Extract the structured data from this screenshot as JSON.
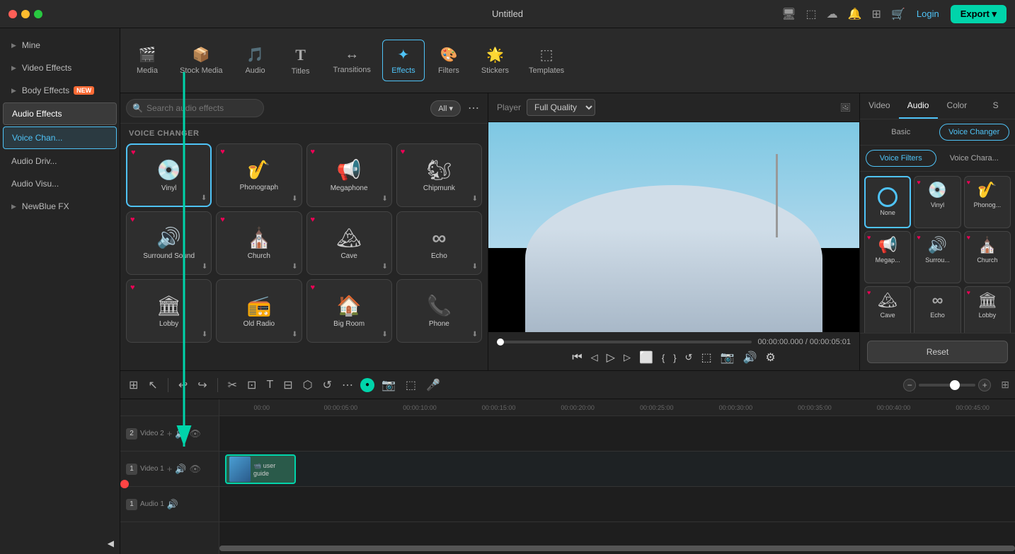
{
  "titlebar": {
    "title": "Untitled",
    "login_label": "Login",
    "export_label": "Export ▾"
  },
  "nav": {
    "items": [
      {
        "id": "media",
        "icon": "🎬",
        "label": "Media"
      },
      {
        "id": "stock_media",
        "icon": "📦",
        "label": "Stock Media"
      },
      {
        "id": "audio",
        "icon": "🎵",
        "label": "Audio"
      },
      {
        "id": "titles",
        "icon": "T",
        "label": "Titles"
      },
      {
        "id": "transitions",
        "icon": "↔",
        "label": "Transitions"
      },
      {
        "id": "effects",
        "icon": "✨",
        "label": "Effects",
        "active": true
      },
      {
        "id": "filters",
        "icon": "🎨",
        "label": "Filters"
      },
      {
        "id": "stickers",
        "icon": "🌟",
        "label": "Stickers"
      },
      {
        "id": "templates",
        "icon": "⬜",
        "label": "Templates"
      }
    ]
  },
  "sidebar": {
    "items": [
      {
        "id": "mine",
        "label": "Mine",
        "arrow": "▶"
      },
      {
        "id": "video_effects",
        "label": "Video Effects",
        "arrow": "▶"
      },
      {
        "id": "body_effects",
        "label": "Body Effects",
        "badge": "NEW",
        "arrow": "▶"
      },
      {
        "id": "audio_effects",
        "label": "Audio Effects",
        "active": true
      },
      {
        "id": "voice_chan",
        "label": "Voice Chan...",
        "active_sub": true
      },
      {
        "id": "audio_driv",
        "label": "Audio Driv..."
      },
      {
        "id": "audio_visu",
        "label": "Audio Visu..."
      },
      {
        "id": "newblue_fx",
        "label": "NewBlue FX",
        "arrow": "▶"
      }
    ]
  },
  "effects_panel": {
    "search_placeholder": "Search audio effects",
    "filter_label": "All",
    "section_label": "VOICE CHANGER",
    "effects": [
      {
        "id": "vinyl",
        "icon": "💿",
        "label": "Vinyl",
        "heart": true,
        "dl": true,
        "active": true
      },
      {
        "id": "phonograph",
        "icon": "🪗",
        "label": "Phonograph",
        "heart": true,
        "dl": true
      },
      {
        "id": "megaphone",
        "icon": "📢",
        "label": "Megaphone",
        "heart": true,
        "dl": true
      },
      {
        "id": "chipmunk",
        "icon": "🐿",
        "label": "Chipmunk",
        "heart": true,
        "dl": true
      },
      {
        "id": "surround_sound",
        "icon": "🔊",
        "label": "Surround Sound",
        "heart": true,
        "dl": true
      },
      {
        "id": "church",
        "icon": "⛪",
        "label": "Church",
        "heart": true,
        "dl": true
      },
      {
        "id": "cave",
        "icon": "🏔",
        "label": "Cave",
        "heart": true,
        "dl": true
      },
      {
        "id": "echo",
        "icon": "∞",
        "label": "Echo",
        "dl": true
      },
      {
        "id": "lobby",
        "icon": "🏛",
        "label": "Lobby",
        "heart": true,
        "dl": true
      },
      {
        "id": "old_radio",
        "icon": "📻",
        "label": "Old Radio",
        "dl": true
      },
      {
        "id": "big_room",
        "icon": "🏠",
        "label": "Big Room",
        "heart": true,
        "dl": true
      },
      {
        "id": "phone",
        "icon": "📞",
        "label": "Phone",
        "dl": true
      }
    ]
  },
  "player": {
    "label": "Player",
    "quality": "Full Quality",
    "time_current": "00:00:00.000",
    "time_total": "00:00:05:01"
  },
  "right_panel": {
    "tabs": [
      "Video",
      "Audio",
      "Color",
      "S"
    ],
    "active_tab": "Audio",
    "subtabs": [
      "Basic",
      "Voice Changer"
    ],
    "active_subtab": "Voice Changer",
    "filter_tabs": [
      "Voice Filters",
      "Voice Chara..."
    ],
    "active_filter": "Voice Filters",
    "effects": [
      {
        "id": "none",
        "label": "None",
        "special": "none",
        "active": true
      },
      {
        "id": "vinyl",
        "icon": "💿",
        "label": "Vinyl",
        "heart": true
      },
      {
        "id": "phonograph",
        "icon": "🪗",
        "label": "Phonog...",
        "heart": true
      },
      {
        "id": "megaphone",
        "icon": "📢",
        "label": "Megap...",
        "heart": true
      },
      {
        "id": "surround",
        "icon": "🔊",
        "label": "Surrou...",
        "heart": true
      },
      {
        "id": "church",
        "icon": "⛪",
        "label": "Church",
        "heart": true
      },
      {
        "id": "cave",
        "icon": "🏔",
        "label": "Cave",
        "heart": true
      },
      {
        "id": "echo",
        "icon": "∞",
        "label": "Echo"
      },
      {
        "id": "lobby",
        "icon": "🏛",
        "label": "Lobby",
        "heart": true
      }
    ],
    "reset_label": "Reset"
  },
  "timeline": {
    "ruler_marks": [
      "00:00",
      "00:00:05:00",
      "00:00:10:00",
      "00:00:15:00",
      "00:00:20:00",
      "00:00:25:00",
      "00:00:30:00",
      "00:00:35:00",
      "00:00:40:00",
      "00:00:45:00"
    ],
    "tracks": [
      {
        "id": "video2",
        "label": "Video 2",
        "number": 2
      },
      {
        "id": "video1",
        "label": "Video 1",
        "number": 1,
        "has_clip": true
      },
      {
        "id": "audio1",
        "label": "Audio 1",
        "number": 1
      }
    ],
    "clip_label": "user guide"
  }
}
